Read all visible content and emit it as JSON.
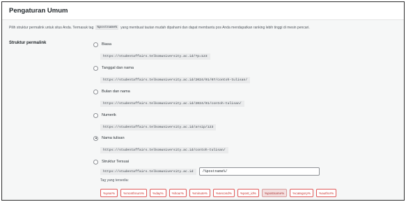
{
  "header": {
    "title": "Pengaturan Umum"
  },
  "description": {
    "before": "Pilih struktur permalink untuk situs Anda. Termasuk tag",
    "tag": "%postname%",
    "after": "yang membuat tautan mudah dipahami dan dapat membantu pos Anda mendapatkan ranking lebih tinggi di mesin pencari."
  },
  "permalink": {
    "label": "Struktur permalink",
    "options": [
      {
        "label": "Biasa",
        "url": "https://studentaffairs.telkomuniversity.ac.id/?p=123",
        "checked": false
      },
      {
        "label": "Tanggal dan nama",
        "url": "https://studentaffairs.telkomuniversity.ac.id/2024/01/07/contoh-tulisan/",
        "checked": false
      },
      {
        "label": "Bulan dan nama",
        "url": "https://studentaffairs.telkomuniversity.ac.id/2024/01/contoh-tulisan/",
        "checked": false
      },
      {
        "label": "Numerik",
        "url": "https://studentaffairs.telkomuniversity.ac.id/arsip/123",
        "checked": false
      },
      {
        "label": "Nama tulisan",
        "url": "https://studentaffairs.telkomuniversity.ac.id/contoh-tulisan/",
        "checked": true
      }
    ],
    "custom": {
      "label": "Struktur Tersuai",
      "base_url": "https://studentaffairs.telkomuniversity.ac.id",
      "value": "/%postname%/",
      "checked": false
    },
    "available_label": "Tag yang tersedia:",
    "tags": [
      "%year%",
      "%monthnum%",
      "%day%",
      "%hour%",
      "%minute%",
      "%second%",
      "%post_id%",
      "%postname%",
      "%category%",
      "%author%"
    ],
    "active_tag": "%postname%"
  }
}
